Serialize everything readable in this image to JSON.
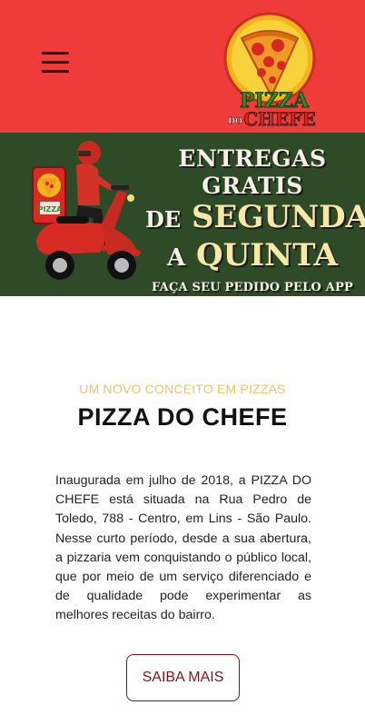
{
  "header": {
    "menu_icon": "hamburger-menu-icon",
    "logo_text_top": "PIZZA",
    "logo_text_bottom_prefix": "DO",
    "logo_text_bottom": "CHEFE",
    "colors": {
      "background": "#ef3b39"
    }
  },
  "banner": {
    "line1": "ENTREGAS GRATIS",
    "line2_prefix": "DE",
    "line2_main": "SEGUNDA",
    "line3_prefix": "A",
    "line3_main": "QUINTA",
    "line4": "FAÇA SEU PEDIDO PELO APP",
    "colors": {
      "background": "#2f4a26",
      "highlight": "#f6e9a8"
    }
  },
  "content": {
    "subtitle": "UM NOVO CONCEITO EM PIZZAS",
    "title": "PIZZA DO CHEFE",
    "description": "Inaugurada em julho de 2018, a PIZZA DO CHEFE está situada na Rua Pedro de Toledo, 788 - Centro, em Lins - São Paulo. Nesse curto período, desde a sua abertura, a pizzaria vem conquistando o público local, que por meio de um serviço diferenciado e de qualidade pode experimentar as melhores receitas do bairro.",
    "cta_label": "SAIBA MAIS",
    "colors": {
      "subtitle": "#e8c46a",
      "cta": "#7a1517"
    }
  }
}
